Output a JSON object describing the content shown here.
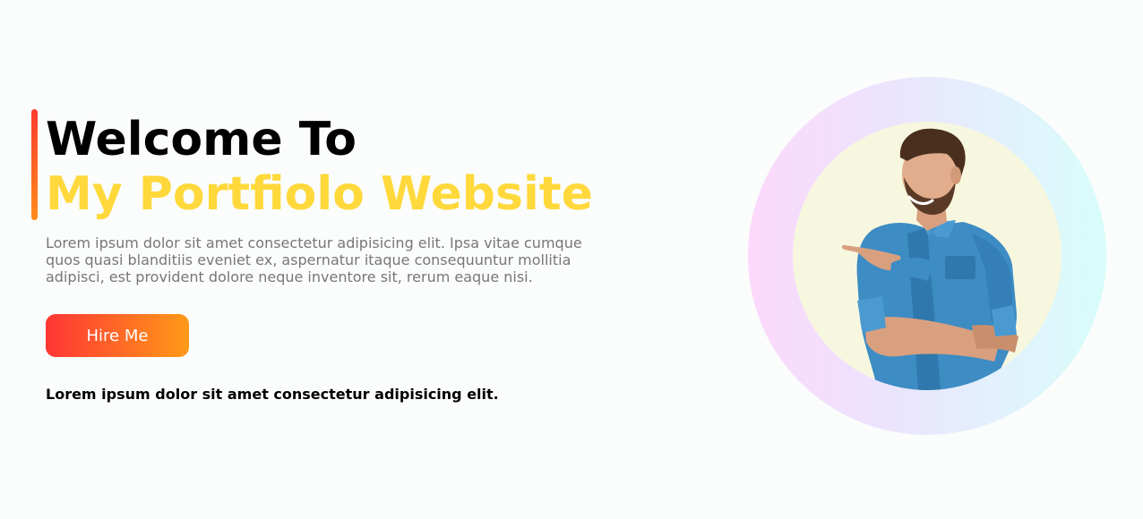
{
  "hero": {
    "title_line1": "Welcome To",
    "title_line2": "My Portfiolo Website",
    "description": "Lorem ipsum dolor sit amet consectetur adipisicing elit. Ipsa vitae cumque quos quasi blanditiis eveniet ex, aspernatur itaque consequuntur mollitia adipisci, est provident dolore neque inventore sit, rerum eaque nisi.",
    "button_label": "Hire Me",
    "tagline": "Lorem ipsum dolor sit amet consectetur adipisicing elit."
  },
  "colors": {
    "accent_start": "#ff3535",
    "accent_end": "#ff9a18",
    "title_highlight": "#ffd93b",
    "background": "#fbfcfc"
  },
  "image": {
    "subject": "smiling man in denim shirt pointing left"
  }
}
